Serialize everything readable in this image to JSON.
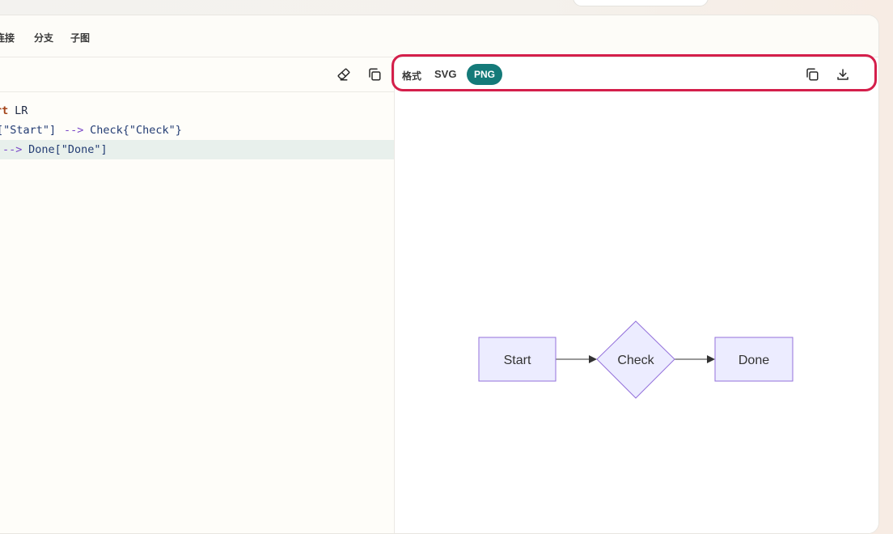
{
  "tabs": [
    {
      "label": "连接"
    },
    {
      "label": "分支"
    },
    {
      "label": "子图"
    }
  ],
  "editor": {
    "lines": [
      {
        "kw": "rt",
        "rest": " LR"
      },
      {
        "p1": "[\"Start\"] ",
        "arrow": "-->",
        "p2": " Check{\"Check\"}"
      },
      {
        "arrow": "-->",
        "p2": " Done[\"Done\"]"
      }
    ]
  },
  "preview": {
    "format_label": "格式",
    "svg_label": "SVG",
    "png_label": "PNG",
    "selected_format": "PNG"
  },
  "diagram": {
    "nodes": [
      {
        "id": "start",
        "label": "Start"
      },
      {
        "id": "check",
        "label": "Check"
      },
      {
        "id": "done",
        "label": "Done"
      }
    ],
    "colors": {
      "node_fill": "#ececff",
      "node_stroke": "#9370db",
      "edge": "#333333",
      "accent": "#147a79",
      "highlight": "#d41f4b"
    }
  },
  "icons": {
    "eraser": "eraser-icon",
    "copy": "copy-icon",
    "download": "download-icon"
  }
}
